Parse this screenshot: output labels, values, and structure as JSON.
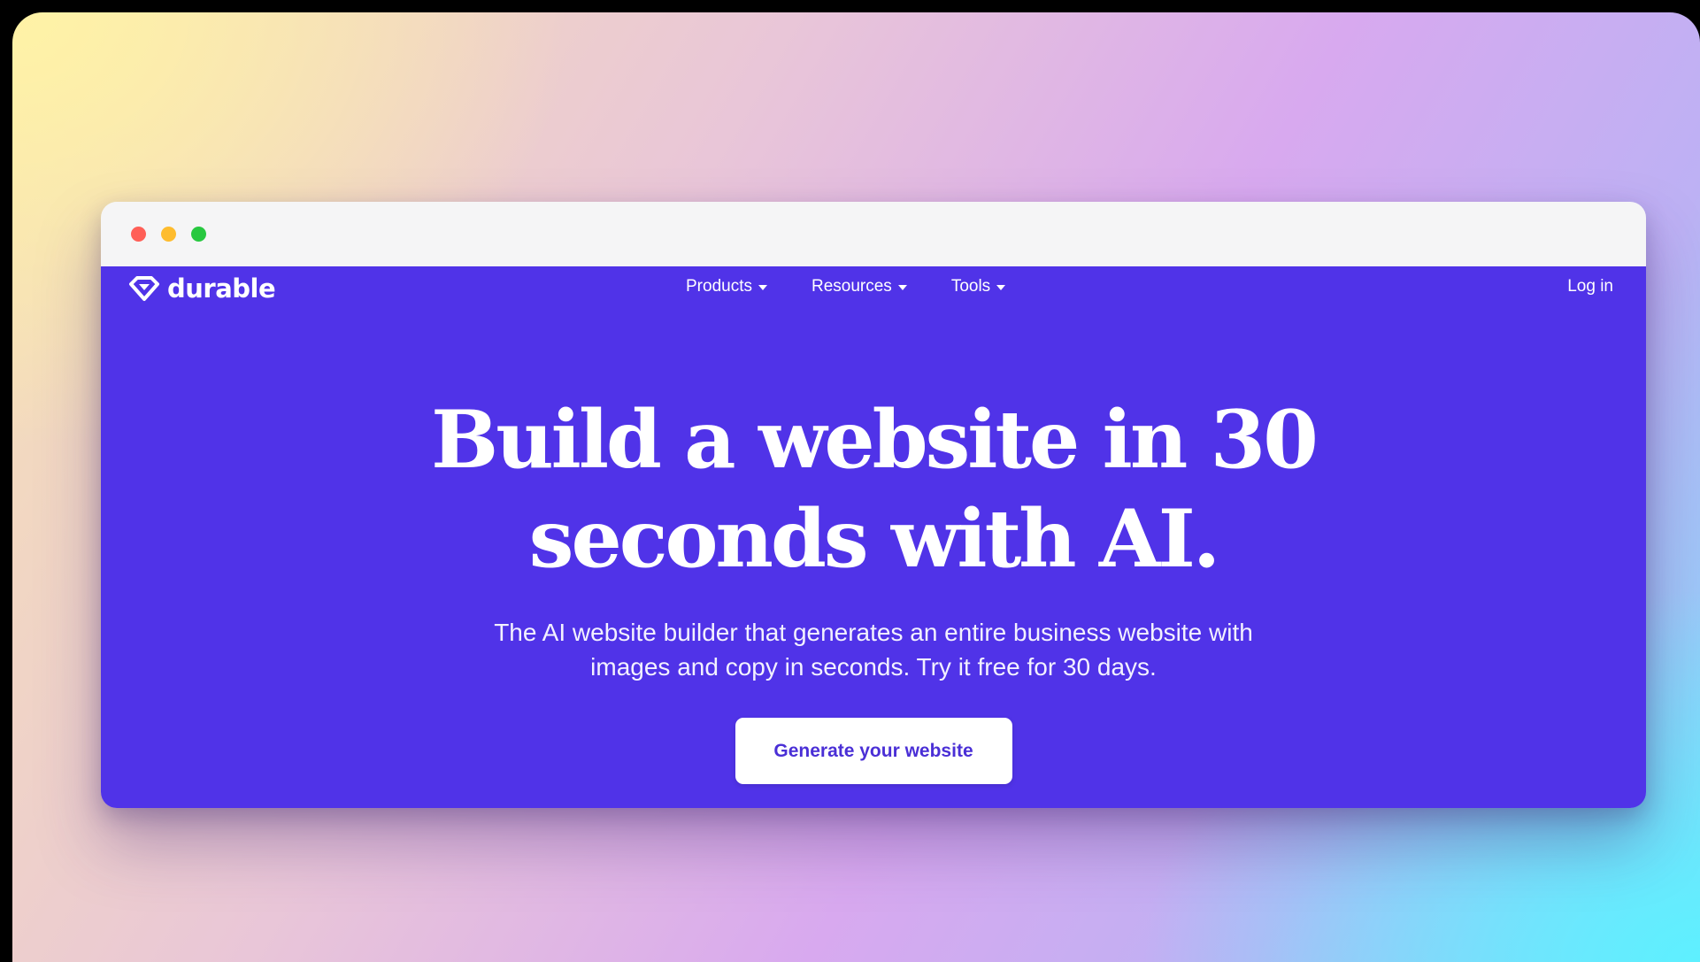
{
  "browser": {
    "window_controls": [
      "close",
      "minimize",
      "maximize"
    ]
  },
  "nav": {
    "logo_text": "durable",
    "logo_icon": "diamond-logo-icon",
    "menu": [
      {
        "label": "Products",
        "icon": "chevron-down-icon"
      },
      {
        "label": "Resources",
        "icon": "chevron-down-icon"
      },
      {
        "label": "Tools",
        "icon": "chevron-down-icon"
      }
    ],
    "login_label": "Log in"
  },
  "hero": {
    "headline": "Build a website in 30 seconds with AI.",
    "subtitle": "The AI website builder that generates an entire business website with images and copy in seconds. Try it free for 30 days.",
    "cta_label": "Generate your website"
  },
  "colors": {
    "page_background": "#5033e8",
    "cta_text": "#4a2fd6",
    "close": "#ff5f57",
    "minimize": "#febc2e",
    "maximize": "#28c840"
  }
}
